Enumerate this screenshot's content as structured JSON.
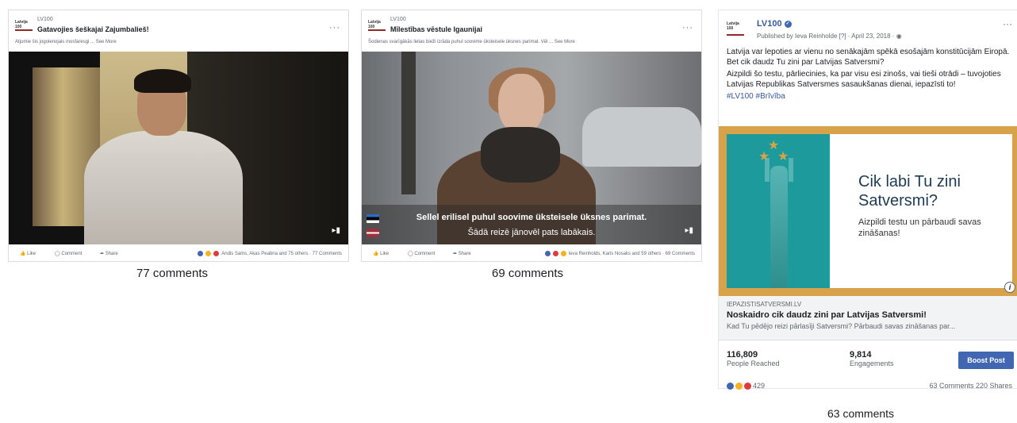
{
  "colors": {
    "like_blue": "#4267b2",
    "love_red": "#e0393e",
    "haha_yellow": "#f7b125",
    "accent_gold": "#d8a24a",
    "accent_teal": "#1d9a9c"
  },
  "actions": {
    "like": "Like",
    "comment": "Comment",
    "share": "Share"
  },
  "icons": {
    "like": "thumbs-up-icon",
    "comment": "speech-bubble-icon",
    "share": "share-arrow-icon",
    "sound": "speaker-icon",
    "more": "ellipsis-icon",
    "info": "info-icon"
  },
  "post1": {
    "page_name": "LV100",
    "title": "Gatavojies šeškajai Zajumbalieš!",
    "description": "Atjumie šis jogolenojais mosfaresgi ... See More",
    "reactions": "Andis Sams, Akas Peabria and 75 others · 77 Comments",
    "caption": "77 comments"
  },
  "post2": {
    "page_name": "LV100",
    "title": "Mīlestības vēstule Igaunijai",
    "description": "Šodienas svarīgākās lietas bieži izrāda puhul soovime üksteisele üksnes parimat. Vēl ... See More",
    "subtitle_line1": "Sellel erilisel puhul soovime üksteisele üksnes parimat.",
    "subtitle_line2": "Šādā reizē jānovēl pats labākais.",
    "reactions": "Ieva Reinholds, Karis Nosaks and 59 others · 69 Comments",
    "caption": "69 comments"
  },
  "post3": {
    "logo": "Latvija 100",
    "page_name": "LV100",
    "meta": "Published by Ieva Reinholde [?] · April 23, 2018 ·",
    "text1": "Latvija var lepoties ar vienu no senākajām spēkā esošajām konstitūcijām Eiropā. Bet cik daudz Tu zini par Latvijas Satversmi?",
    "text2": "Aizpildi šo testu, pārliecinies, ka par visu esi zinošs, vai tieši otrādi – tuvojoties Latvijas Republikas Satversmes sasaukšanas dienai, iepazīsti to!",
    "tags": "#LV100 #Brīvība",
    "image_title": "Cik labi Tu zini Satversmi?",
    "image_sub": "Aizpildi testu un pārbaudi savas zināšanas!",
    "link_domain": "IEPAZISTISATVERSMI.LV",
    "link_title": "Noskaidro cik daudz zini par Latvijas Satversmi!",
    "link_desc": "Kad Tu pēdējo reizi pārlasīji Satversmi? Pārbaudi savas zināšanas par...",
    "reached_num": "116,809",
    "reached_lbl": "People Reached",
    "eng_num": "9,814",
    "eng_lbl": "Engagements",
    "boost": "Boost Post",
    "reaction_count": "429",
    "counts": "63 Comments  220 Shares",
    "caption": "63 comments"
  }
}
